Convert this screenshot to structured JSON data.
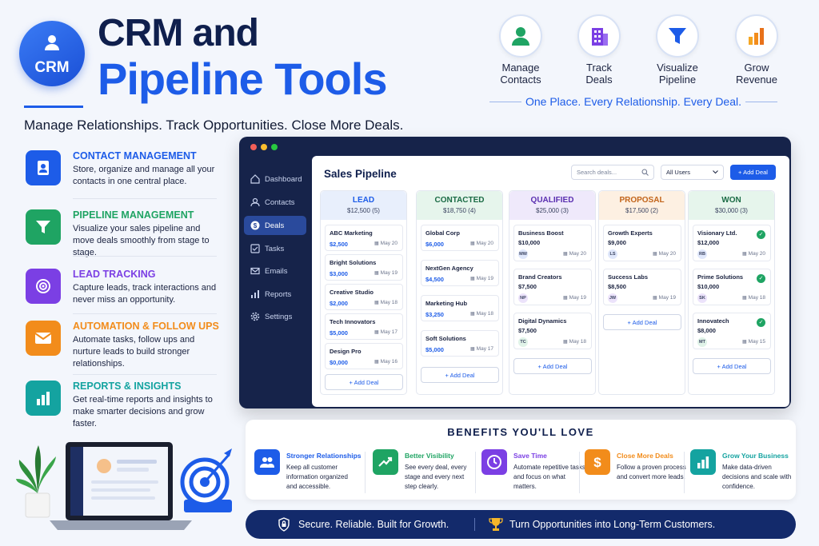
{
  "header": {
    "logo_text": "CRM",
    "title_line1": "CRM and",
    "title_line2": "Pipeline Tools",
    "subtitle": "Manage Relationships. Track Opportunities. Close More Deals."
  },
  "top_features": [
    {
      "label1": "Manage",
      "label2": "Contacts",
      "icon": "person-icon",
      "color": "#1fa463"
    },
    {
      "label1": "Track",
      "label2": "Deals",
      "icon": "building-icon",
      "color": "#7b3fe4"
    },
    {
      "label1": "Visualize",
      "label2": "Pipeline",
      "icon": "funnel-icon",
      "color": "#1d5ce8"
    },
    {
      "label1": "Grow",
      "label2": "Revenue",
      "icon": "bar-chart-icon",
      "color": "#f28c1b"
    }
  ],
  "tagline": "One Place. Every Relationship. Every Deal.",
  "features": [
    {
      "title": "CONTACT MANAGEMENT",
      "desc": "Store, organize and manage all your contacts in one central place.",
      "color": "#1d5ce8"
    },
    {
      "title": "PIPELINE MANAGEMENT",
      "desc": "Visualize your sales pipeline and move deals smoothly from stage to stage.",
      "color": "#1fa463"
    },
    {
      "title": "LEAD TRACKING",
      "desc": "Capture leads, track interactions and never miss an opportunity.",
      "color": "#7b3fe4"
    },
    {
      "title": "AUTOMATION & FOLLOW UPS",
      "desc": "Automate tasks, follow ups and nurture leads to build stronger relationships.",
      "color": "#f28c1b"
    },
    {
      "title": "REPORTS & INSIGHTS",
      "desc": "Get real-time reports and insights to make smarter decisions and grow faster.",
      "color": "#14a3a0"
    }
  ],
  "sidebar": {
    "items": [
      "Dashboard",
      "Contacts",
      "Deals",
      "Tasks",
      "Emails",
      "Reports",
      "Settings"
    ]
  },
  "pipeline": {
    "title": "Sales Pipeline",
    "search_placeholder": "Search deals...",
    "filter": "All Users",
    "add_deal": "+ Add Deal",
    "add_card": "+ Add Deal",
    "columns": [
      {
        "name": "LEAD",
        "total": "$12,500 (5)",
        "color": "#1d5ce8",
        "bg": "#e8effc",
        "cards": [
          {
            "name": "ABC Marketing",
            "amount": "$2,500",
            "date": "May 20"
          },
          {
            "name": "Bright Solutions",
            "amount": "$3,000",
            "date": "May 19"
          },
          {
            "name": "Creative Studio",
            "amount": "$2,000",
            "date": "May 18"
          },
          {
            "name": "Tech Innovators",
            "amount": "$5,000",
            "date": "May 17"
          },
          {
            "name": "Design Pro",
            "amount": "$0,000",
            "date": "May 16"
          }
        ]
      },
      {
        "name": "CONTACTED",
        "total": "$18,750 (4)",
        "color": "#1b6b45",
        "bg": "#e6f5ec",
        "cards": [
          {
            "name": "Global Corp",
            "amount": "$6,000",
            "date": "May 20"
          },
          {
            "name": "NextGen Agency",
            "amount": "$4,500",
            "date": "May 19"
          },
          {
            "name": "Marketing Hub",
            "amount": "$3,250",
            "date": "May 18"
          },
          {
            "name": "Soft Solutions",
            "amount": "$5,000",
            "date": "May 17"
          }
        ]
      },
      {
        "name": "QUALIFIED",
        "total": "$25,000 (3)",
        "color": "#5a2fb0",
        "bg": "#efe9fb",
        "cards": [
          {
            "name": "Business Boost",
            "amount": "$10,000",
            "date": "May 20",
            "avatar": "MW"
          },
          {
            "name": "Brand Creators",
            "amount": "$7,500",
            "date": "May 19",
            "avatar": "NP"
          },
          {
            "name": "Digital Dynamics",
            "amount": "$7,500",
            "date": "May 18",
            "avatar": "TC"
          }
        ]
      },
      {
        "name": "PROPOSAL",
        "total": "$17,500 (2)",
        "color": "#c2641a",
        "bg": "#fdf0e2",
        "cards": [
          {
            "name": "Growth Experts",
            "amount": "$9,000",
            "date": "May 20",
            "avatar": "LS"
          },
          {
            "name": "Success Labs",
            "amount": "$8,500",
            "date": "May 19",
            "avatar": "JW"
          }
        ]
      },
      {
        "name": "WON",
        "total": "$30,000 (3)",
        "color": "#1b6b45",
        "bg": "#e6f5ec",
        "cards": [
          {
            "name": "Visionary Ltd.",
            "amount": "$12,000",
            "date": "May 20",
            "avatar": "RB"
          },
          {
            "name": "Prime Solutions",
            "amount": "$10,000",
            "date": "May 18",
            "avatar": "SK"
          },
          {
            "name": "Innovatech",
            "amount": "$8,000",
            "date": "May 15",
            "avatar": "MT"
          }
        ]
      }
    ]
  },
  "benefits": {
    "title": "BENEFITS YOU'LL LOVE",
    "items": [
      {
        "title": "Stronger Relationships",
        "desc": "Keep all customer information organized and accessible.",
        "color": "#1d5ce8"
      },
      {
        "title": "Better Visibility",
        "desc": "See every deal, every stage and every next step clearly.",
        "color": "#1fa463"
      },
      {
        "title": "Save Time",
        "desc": "Automate repetitive tasks and focus on what matters.",
        "color": "#7b3fe4"
      },
      {
        "title": "Close More Deals",
        "desc": "Follow a proven process and convert more leads.",
        "color": "#f28c1b"
      },
      {
        "title": "Grow Your Business",
        "desc": "Make data-driven decisions and scale with confidence.",
        "color": "#14a3a0"
      }
    ]
  },
  "footer": {
    "left": "Secure. Reliable. Built for Growth.",
    "right": "Turn Opportunities into Long-Term Customers."
  }
}
